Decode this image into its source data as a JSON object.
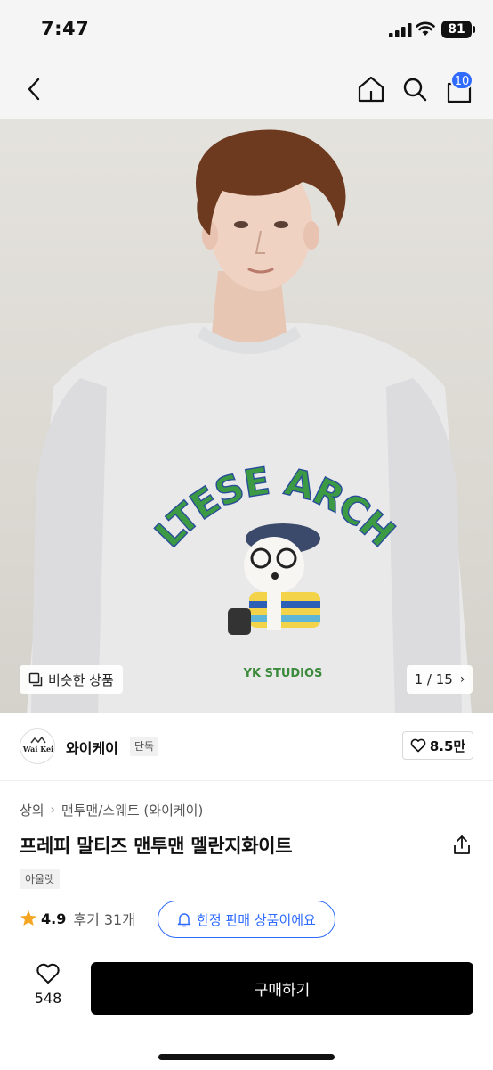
{
  "status_bar": {
    "time": "7:47",
    "battery": "81"
  },
  "nav": {
    "cart_count": "10"
  },
  "image": {
    "similar_label": "비슷한 상품",
    "page_indicator": "1 / 15",
    "print_text": "MALTESE ARCHIVE",
    "print_subtext": "YK STUDIOS"
  },
  "brand": {
    "name": "와이케이",
    "badge": "단독",
    "likes": "8.5만",
    "logo_text": "Wai Kei"
  },
  "breadcrumb": {
    "items": [
      "상의",
      "맨투맨/스웨트 (와이케이)"
    ]
  },
  "product": {
    "title": "프레피 말티즈 맨투맨 멜란지화이트",
    "badge": "아울렛"
  },
  "rating": {
    "value": "4.9",
    "reviews": "후기 31개"
  },
  "limited": {
    "label": "한정 판매 상품이에요"
  },
  "bottom_bar": {
    "wish_count": "548",
    "buy_label": "구매하기"
  },
  "colors": {
    "accent": "#2f6bff",
    "buy_button": "#000000",
    "star": "#f5a623"
  }
}
